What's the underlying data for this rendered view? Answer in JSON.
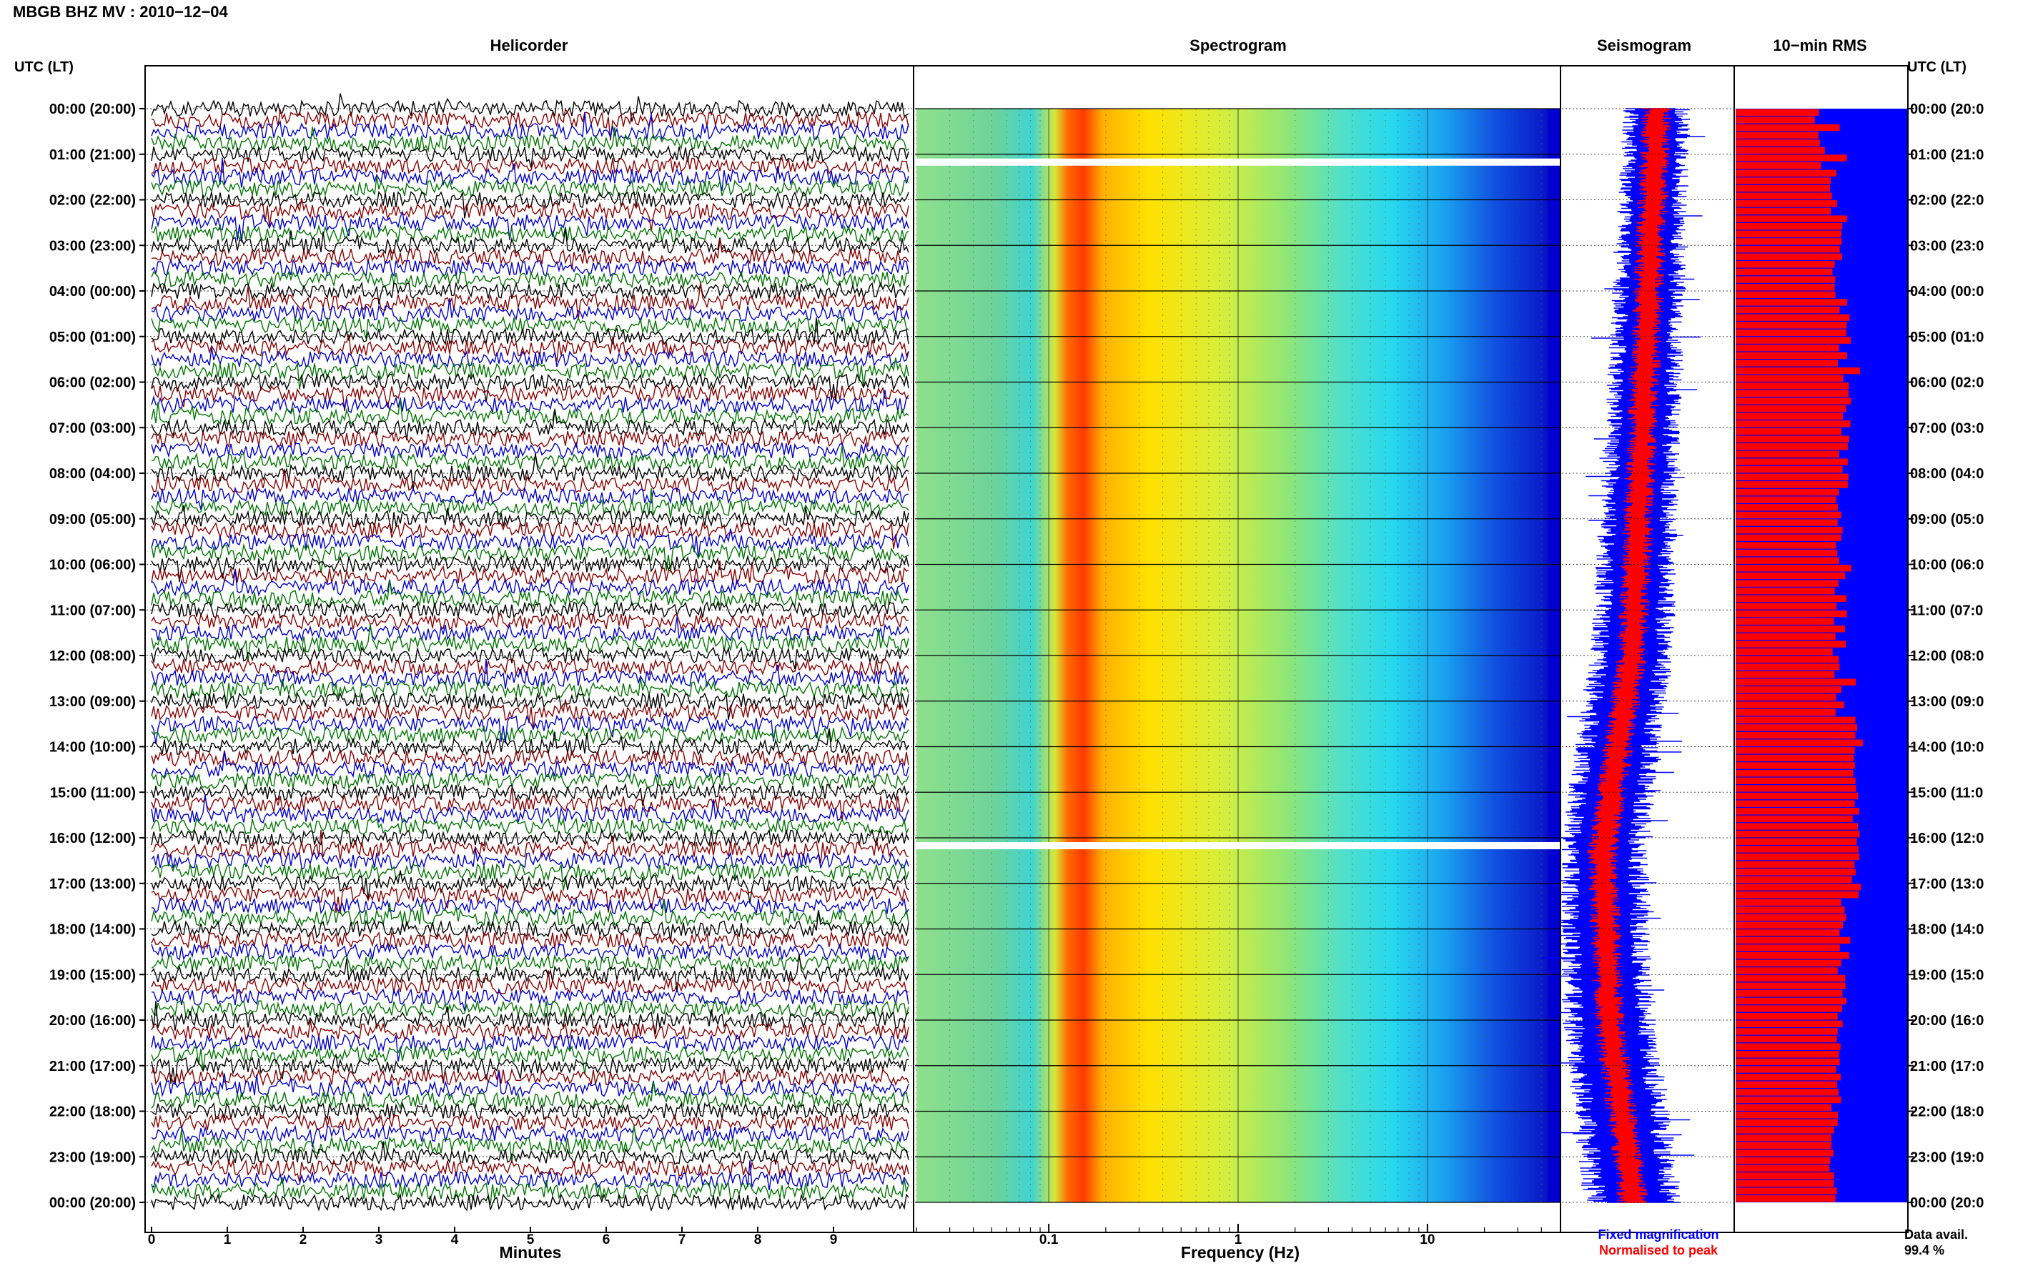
{
  "title": "MBGB BHZ MV : 2010−12−04",
  "left_axis_label": "UTC (LT)",
  "right_axis_label": "UTC (LT)",
  "time_labels": [
    "00:00 (20:00)",
    "01:00 (21:00)",
    "02:00 (22:00)",
    "03:00 (23:00)",
    "04:00 (00:00)",
    "05:00 (01:00)",
    "06:00 (02:00)",
    "07:00 (03:00)",
    "08:00 (04:00)",
    "09:00 (05:00)",
    "10:00 (06:00)",
    "11:00 (07:00)",
    "12:00 (08:00)",
    "13:00 (09:00)",
    "14:00 (10:00)",
    "15:00 (11:00)",
    "16:00 (12:00)",
    "17:00 (13:00)",
    "18:00 (14:00)",
    "19:00 (15:00)",
    "20:00 (16:00)",
    "21:00 (17:00)",
    "22:00 (18:00)",
    "23:00 (19:00)",
    "00:00 (20:00)"
  ],
  "right_time_labels": [
    "00:00 (20:0",
    "01:00 (21:0",
    "02:00 (22:0",
    "03:00 (23:0",
    "04:00 (00:0",
    "05:00 (01:0",
    "06:00 (02:0",
    "07:00 (03:0",
    "08:00 (04:0",
    "09:00 (05:0",
    "10:00 (06:0",
    "11:00 (07:0",
    "12:00 (08:0",
    "13:00 (09:0",
    "14:00 (10:0",
    "15:00 (11:0",
    "16:00 (12:0",
    "17:00 (13:0",
    "18:00 (14:0",
    "19:00 (15:0",
    "20:00 (16:0",
    "21:00 (17:0",
    "22:00 (18:0",
    "23:00 (19:0",
    "00:00 (20:0"
  ],
  "colors": {
    "trace_colors": [
      "#000000",
      "#8b0000",
      "#0000cc",
      "#007700"
    ],
    "fixed": "#0000ff",
    "normalised": "#ff0000"
  },
  "chart_data": [
    {
      "type": "line",
      "panel": "Helicorder",
      "title": "Helicorder",
      "xlabel": "Minutes",
      "x_ticks": [
        0,
        1,
        2,
        3,
        4,
        5,
        6,
        7,
        8,
        9
      ],
      "xlim": [
        0,
        10
      ],
      "rows_per_hour": 4,
      "hours": 24
    },
    {
      "type": "heatmap",
      "panel": "Spectrogram",
      "title": "Spectrogram",
      "xlabel": "Frequency (Hz)",
      "x_scale": "log",
      "x_ticks": [
        0.1,
        1,
        10
      ],
      "x_tick_labels": [
        "0.1",
        "1",
        "10"
      ],
      "xlim": [
        0.02,
        50
      ],
      "peak_frequency_hz": 0.17,
      "data_gaps_utc": [
        "01:00",
        "16:00"
      ]
    },
    {
      "type": "line",
      "panel": "Seismogram",
      "title": "Seismogram",
      "legend": [
        "Fixed magnification",
        "Normalised to peak"
      ],
      "legend_position": "bottom"
    },
    {
      "type": "bar",
      "panel": "10-min RMS",
      "title": "10−min RMS",
      "orientation": "horizontal",
      "interval_minutes": 10,
      "data_availability_label": "Data avail.",
      "data_availability": "99.4 %"
    }
  ]
}
